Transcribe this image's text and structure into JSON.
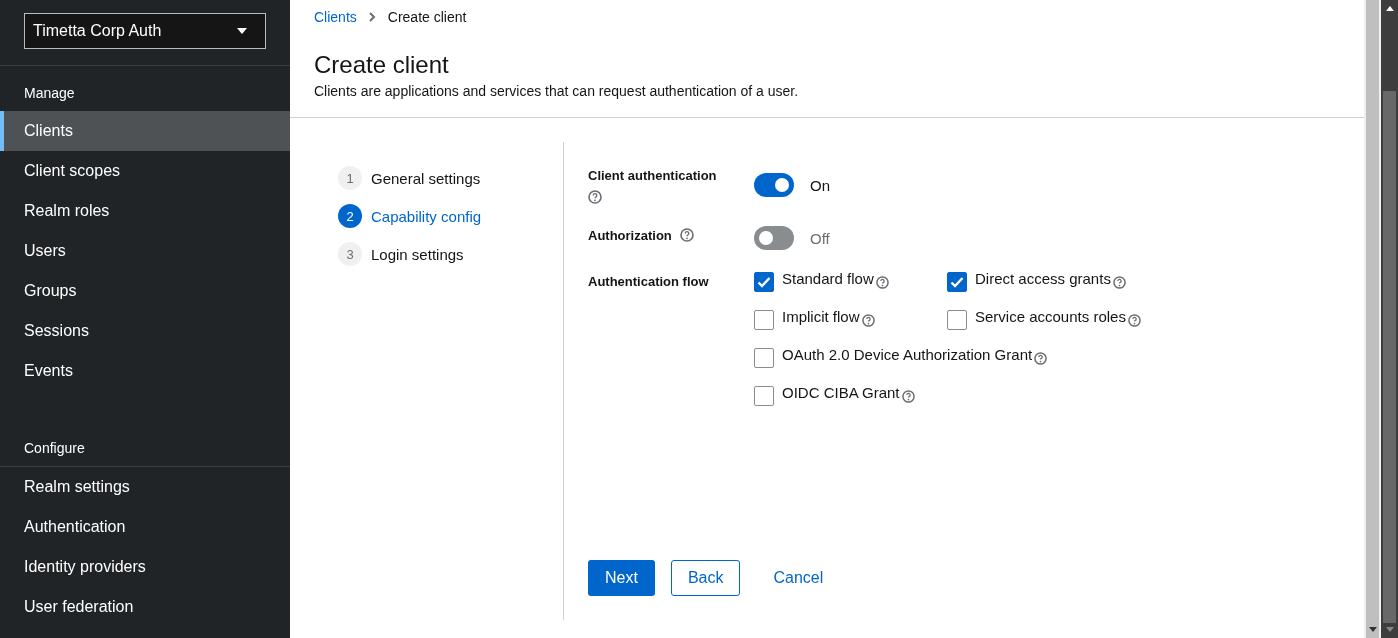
{
  "realm_selector": {
    "value": "Timetta Corp Auth"
  },
  "nav": [
    {
      "heading": "Manage",
      "items": [
        {
          "label": "Clients",
          "selected": true
        },
        {
          "label": "Client scopes",
          "selected": false
        },
        {
          "label": "Realm roles",
          "selected": false
        },
        {
          "label": "Users",
          "selected": false
        },
        {
          "label": "Groups",
          "selected": false
        },
        {
          "label": "Sessions",
          "selected": false
        },
        {
          "label": "Events",
          "selected": false
        }
      ]
    },
    {
      "heading": "Configure",
      "items": [
        {
          "label": "Realm settings",
          "selected": false
        },
        {
          "label": "Authentication",
          "selected": false
        },
        {
          "label": "Identity providers",
          "selected": false
        },
        {
          "label": "User federation",
          "selected": false
        }
      ]
    }
  ],
  "breadcrumb": [
    {
      "label": "Clients",
      "kind": "link"
    },
    {
      "label": "Create client",
      "kind": "current"
    }
  ],
  "page": {
    "title": "Create client",
    "description": "Clients are applications and services that can request authentication of a user."
  },
  "steps": [
    {
      "number": "1",
      "label": "General settings",
      "selected": false
    },
    {
      "number": "2",
      "label": "Capability config",
      "selected": true
    },
    {
      "number": "3",
      "label": "Login settings",
      "selected": false
    }
  ],
  "fields": [
    {
      "kind": "switch",
      "label": "Client authentication",
      "on": true,
      "state_text": "On"
    },
    {
      "kind": "switch",
      "label": "Authorization",
      "on": false,
      "state_text": "Off"
    },
    {
      "kind": "checkboxes",
      "label": "Authentication flow",
      "options": [
        {
          "label": "Standard flow",
          "checked": true
        },
        {
          "label": "Direct access grants",
          "checked": true
        },
        {
          "label": "Implicit flow",
          "checked": false
        },
        {
          "label": "Service accounts roles",
          "checked": false
        },
        {
          "label": "OAuth 2.0 Device Authorization Grant",
          "checked": false
        },
        {
          "label": "OIDC CIBA Grant",
          "checked": false
        }
      ]
    }
  ],
  "buttons": [
    {
      "label": "Next",
      "kind": "primary"
    },
    {
      "label": "Back",
      "kind": "secondary"
    },
    {
      "label": "Cancel",
      "kind": "link"
    }
  ]
}
